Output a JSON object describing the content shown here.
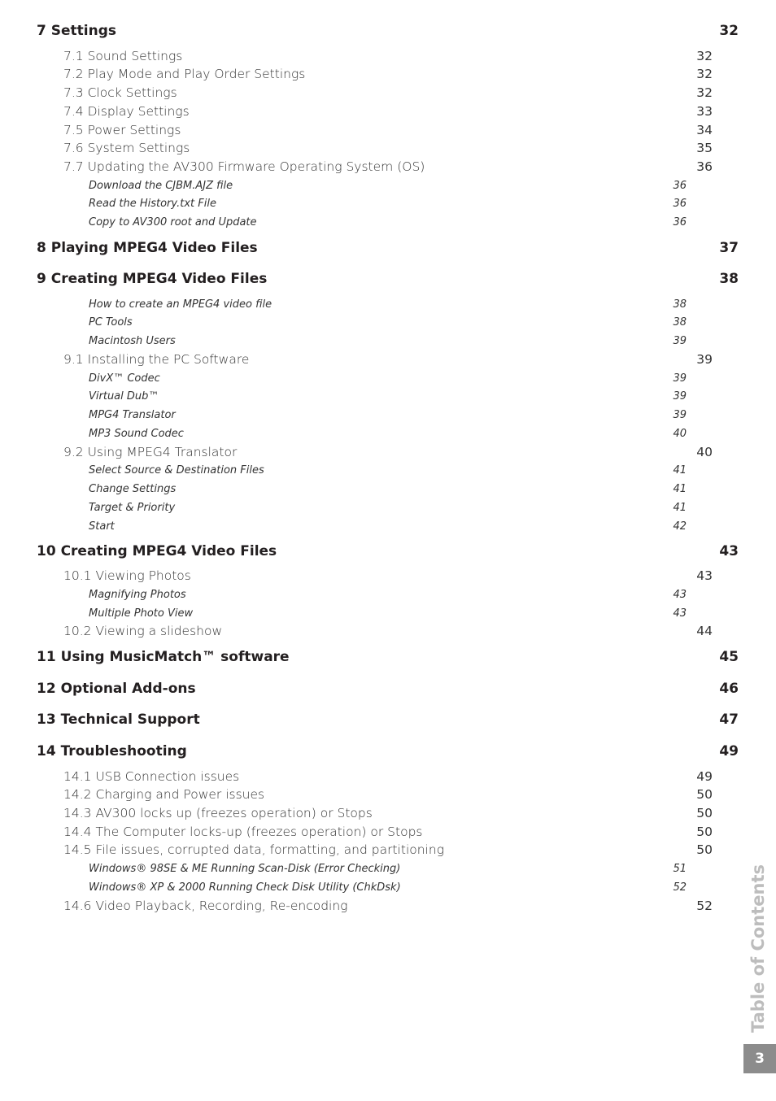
{
  "toc": [
    {
      "level": "h",
      "label": "7  Settings",
      "page": "32"
    },
    {
      "level": "s",
      "label": "7.1 Sound Settings",
      "page": "32"
    },
    {
      "level": "s",
      "label": "7.2 Play Mode and Play Order Settings",
      "page": "32"
    },
    {
      "level": "s",
      "label": "7.3 Clock Settings",
      "page": "32"
    },
    {
      "level": "s",
      "label": "7.4 Display Settings",
      "page": "33"
    },
    {
      "level": "s",
      "label": "7.5 Power Settings",
      "page": "34"
    },
    {
      "level": "s",
      "label": "7.6 System Settings",
      "page": "35"
    },
    {
      "level": "s",
      "label": "7.7 Updating the AV300 Firmware Operating System (OS)",
      "page": "36"
    },
    {
      "level": "t",
      "label": "Download the CJBM.AJZ file",
      "page": "36"
    },
    {
      "level": "t",
      "label": "Read the History.txt File",
      "page": "36"
    },
    {
      "level": "t",
      "label": "Copy to AV300 root and Update",
      "page": "36"
    },
    {
      "level": "h",
      "label": "8  Playing MPEG4 Video Files",
      "page": "37"
    },
    {
      "level": "h",
      "label": "9  Creating MPEG4 Video Files",
      "page": "38"
    },
    {
      "level": "t",
      "label": "How to create an MPEG4 video file",
      "page": "38"
    },
    {
      "level": "t",
      "label": "PC Tools",
      "page": "38"
    },
    {
      "level": "t",
      "label": "Macintosh Users",
      "page": "39"
    },
    {
      "level": "s",
      "label": "9.1 Installing the PC Software",
      "page": "39"
    },
    {
      "level": "t",
      "label": "DivX™ Codec",
      "page": "39"
    },
    {
      "level": "t",
      "label": "Virtual Dub™",
      "page": "39"
    },
    {
      "level": "t",
      "label": "MPG4 Translator",
      "page": "39"
    },
    {
      "level": "t",
      "label": "MP3 Sound Codec",
      "page": "40"
    },
    {
      "level": "s",
      "label": "9.2 Using MPEG4 Translator",
      "page": "40"
    },
    {
      "level": "t",
      "label": "Select Source & Destination Files",
      "page": "41"
    },
    {
      "level": "t",
      "label": "Change Settings",
      "page": "41"
    },
    {
      "level": "t",
      "label": "Target & Priority",
      "page": "41"
    },
    {
      "level": "t",
      "label": "Start",
      "page": "42"
    },
    {
      "level": "h",
      "label": "10 Creating MPEG4 Video Files",
      "page": "43"
    },
    {
      "level": "s",
      "label": "10.1 Viewing Photos",
      "page": "43"
    },
    {
      "level": "t",
      "label": "Magnifying Photos",
      "page": "43"
    },
    {
      "level": "t",
      "label": "Multiple Photo View",
      "page": "43"
    },
    {
      "level": "s",
      "label": "10.2 Viewing a slideshow",
      "page": "44"
    },
    {
      "level": "h",
      "label": "11 Using MusicMatch™ software",
      "page": "45"
    },
    {
      "level": "h",
      "label": "12 Optional Add-ons",
      "page": "46"
    },
    {
      "level": "h",
      "label": "13 Technical Support",
      "page": "47"
    },
    {
      "level": "h",
      "label": "14 Troubleshooting",
      "page": "49"
    },
    {
      "level": "s",
      "label": "14.1 USB Connection issues",
      "page": "49"
    },
    {
      "level": "s",
      "label": "14.2 Charging and Power issues",
      "page": "50"
    },
    {
      "level": "s",
      "label": "14.3 AV300 locks up (freezes operation) or Stops",
      "page": "50"
    },
    {
      "level": "s",
      "label": "14.4 The Computer locks-up (freezes operation) or Stops",
      "page": "50"
    },
    {
      "level": "s",
      "label": "14.5 File issues, corrupted data, formatting, and partitioning",
      "page": "50"
    },
    {
      "level": "t",
      "label": "Windows® 98SE & ME Running Scan-Disk (Error Checking)",
      "page": "51"
    },
    {
      "level": "t",
      "label": "Windows® XP & 2000 Running Check Disk Utility (ChkDsk)",
      "page": "52"
    },
    {
      "level": "s",
      "label": "14.6 Video Playback, Recording, Re-encoding",
      "page": "52"
    }
  ],
  "side_tab": {
    "label": "Table of Contents",
    "page_number": "3"
  }
}
